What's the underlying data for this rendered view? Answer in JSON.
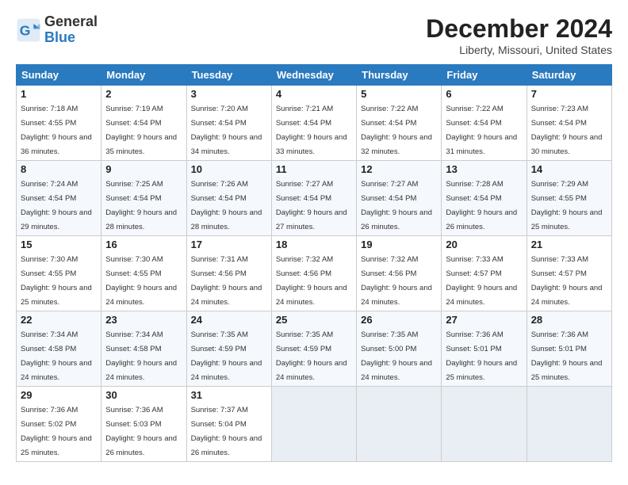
{
  "header": {
    "logo_general": "General",
    "logo_blue": "Blue",
    "title": "December 2024",
    "subtitle": "Liberty, Missouri, United States"
  },
  "weekdays": [
    "Sunday",
    "Monday",
    "Tuesday",
    "Wednesday",
    "Thursday",
    "Friday",
    "Saturday"
  ],
  "weeks": [
    [
      {
        "day": "1",
        "sunrise": "7:18 AM",
        "sunset": "4:55 PM",
        "daylight": "9 hours and 36 minutes."
      },
      {
        "day": "2",
        "sunrise": "7:19 AM",
        "sunset": "4:54 PM",
        "daylight": "9 hours and 35 minutes."
      },
      {
        "day": "3",
        "sunrise": "7:20 AM",
        "sunset": "4:54 PM",
        "daylight": "9 hours and 34 minutes."
      },
      {
        "day": "4",
        "sunrise": "7:21 AM",
        "sunset": "4:54 PM",
        "daylight": "9 hours and 33 minutes."
      },
      {
        "day": "5",
        "sunrise": "7:22 AM",
        "sunset": "4:54 PM",
        "daylight": "9 hours and 32 minutes."
      },
      {
        "day": "6",
        "sunrise": "7:22 AM",
        "sunset": "4:54 PM",
        "daylight": "9 hours and 31 minutes."
      },
      {
        "day": "7",
        "sunrise": "7:23 AM",
        "sunset": "4:54 PM",
        "daylight": "9 hours and 30 minutes."
      }
    ],
    [
      {
        "day": "8",
        "sunrise": "7:24 AM",
        "sunset": "4:54 PM",
        "daylight": "9 hours and 29 minutes."
      },
      {
        "day": "9",
        "sunrise": "7:25 AM",
        "sunset": "4:54 PM",
        "daylight": "9 hours and 28 minutes."
      },
      {
        "day": "10",
        "sunrise": "7:26 AM",
        "sunset": "4:54 PM",
        "daylight": "9 hours and 28 minutes."
      },
      {
        "day": "11",
        "sunrise": "7:27 AM",
        "sunset": "4:54 PM",
        "daylight": "9 hours and 27 minutes."
      },
      {
        "day": "12",
        "sunrise": "7:27 AM",
        "sunset": "4:54 PM",
        "daylight": "9 hours and 26 minutes."
      },
      {
        "day": "13",
        "sunrise": "7:28 AM",
        "sunset": "4:54 PM",
        "daylight": "9 hours and 26 minutes."
      },
      {
        "day": "14",
        "sunrise": "7:29 AM",
        "sunset": "4:55 PM",
        "daylight": "9 hours and 25 minutes."
      }
    ],
    [
      {
        "day": "15",
        "sunrise": "7:30 AM",
        "sunset": "4:55 PM",
        "daylight": "9 hours and 25 minutes."
      },
      {
        "day": "16",
        "sunrise": "7:30 AM",
        "sunset": "4:55 PM",
        "daylight": "9 hours and 24 minutes."
      },
      {
        "day": "17",
        "sunrise": "7:31 AM",
        "sunset": "4:56 PM",
        "daylight": "9 hours and 24 minutes."
      },
      {
        "day": "18",
        "sunrise": "7:32 AM",
        "sunset": "4:56 PM",
        "daylight": "9 hours and 24 minutes."
      },
      {
        "day": "19",
        "sunrise": "7:32 AM",
        "sunset": "4:56 PM",
        "daylight": "9 hours and 24 minutes."
      },
      {
        "day": "20",
        "sunrise": "7:33 AM",
        "sunset": "4:57 PM",
        "daylight": "9 hours and 24 minutes."
      },
      {
        "day": "21",
        "sunrise": "7:33 AM",
        "sunset": "4:57 PM",
        "daylight": "9 hours and 24 minutes."
      }
    ],
    [
      {
        "day": "22",
        "sunrise": "7:34 AM",
        "sunset": "4:58 PM",
        "daylight": "9 hours and 24 minutes."
      },
      {
        "day": "23",
        "sunrise": "7:34 AM",
        "sunset": "4:58 PM",
        "daylight": "9 hours and 24 minutes."
      },
      {
        "day": "24",
        "sunrise": "7:35 AM",
        "sunset": "4:59 PM",
        "daylight": "9 hours and 24 minutes."
      },
      {
        "day": "25",
        "sunrise": "7:35 AM",
        "sunset": "4:59 PM",
        "daylight": "9 hours and 24 minutes."
      },
      {
        "day": "26",
        "sunrise": "7:35 AM",
        "sunset": "5:00 PM",
        "daylight": "9 hours and 24 minutes."
      },
      {
        "day": "27",
        "sunrise": "7:36 AM",
        "sunset": "5:01 PM",
        "daylight": "9 hours and 25 minutes."
      },
      {
        "day": "28",
        "sunrise": "7:36 AM",
        "sunset": "5:01 PM",
        "daylight": "9 hours and 25 minutes."
      }
    ],
    [
      {
        "day": "29",
        "sunrise": "7:36 AM",
        "sunset": "5:02 PM",
        "daylight": "9 hours and 25 minutes."
      },
      {
        "day": "30",
        "sunrise": "7:36 AM",
        "sunset": "5:03 PM",
        "daylight": "9 hours and 26 minutes."
      },
      {
        "day": "31",
        "sunrise": "7:37 AM",
        "sunset": "5:04 PM",
        "daylight": "9 hours and 26 minutes."
      },
      null,
      null,
      null,
      null
    ]
  ],
  "labels": {
    "sunrise": "Sunrise:",
    "sunset": "Sunset:",
    "daylight": "Daylight:"
  }
}
